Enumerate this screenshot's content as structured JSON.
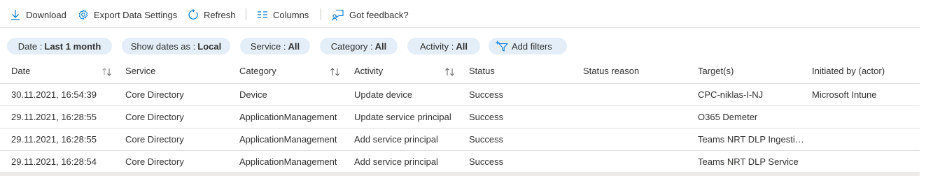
{
  "toolbar": {
    "download": {
      "label": "Download",
      "icon": "download-icon"
    },
    "export": {
      "label": "Export Data Settings",
      "icon": "gear-icon"
    },
    "refresh": {
      "label": "Refresh",
      "icon": "refresh-icon"
    },
    "columns": {
      "label": "Columns",
      "icon": "columns-icon"
    },
    "feedback": {
      "label": "Got feedback?",
      "icon": "feedback-icon"
    }
  },
  "filters": [
    {
      "label": "Date :",
      "value": "Last 1 month"
    },
    {
      "label": "Show dates as :",
      "value": "Local"
    },
    {
      "label": "Service :",
      "value": "All"
    },
    {
      "label": "Category :",
      "value": "All"
    },
    {
      "label": "Activity :",
      "value": "All"
    }
  ],
  "add_filters": {
    "label": "Add filters",
    "icon": "add-filter-icon"
  },
  "table": {
    "columns": [
      "Date",
      "Service",
      "Category",
      "Activity",
      "Status",
      "Status reason",
      "Target(s)",
      "Initiated by (actor)"
    ],
    "rows": [
      [
        "30.11.2021, 16:54:39",
        "Core Directory",
        "Device",
        "Update device",
        "Success",
        "",
        "CPC-niklas-I-NJ",
        "Microsoft Intune"
      ],
      [
        "29.11.2021, 16:28:55",
        "Core Directory",
        "ApplicationManagement",
        "Update service principal",
        "Success",
        "",
        "O365 Demeter",
        ""
      ],
      [
        "29.11.2021, 16:28:55",
        "Core Directory",
        "ApplicationManagement",
        "Add service principal",
        "Success",
        "",
        "Teams NRT DLP Ingestion Service",
        ""
      ],
      [
        "29.11.2021, 16:28:54",
        "Core Directory",
        "ApplicationManagement",
        "Add service principal",
        "Success",
        "",
        "Teams NRT DLP Service",
        ""
      ]
    ]
  },
  "colors": {
    "accent": "#0078d4",
    "pill_bg": "#e4eef8",
    "text": "#323130",
    "border": "#e1dfdd"
  }
}
